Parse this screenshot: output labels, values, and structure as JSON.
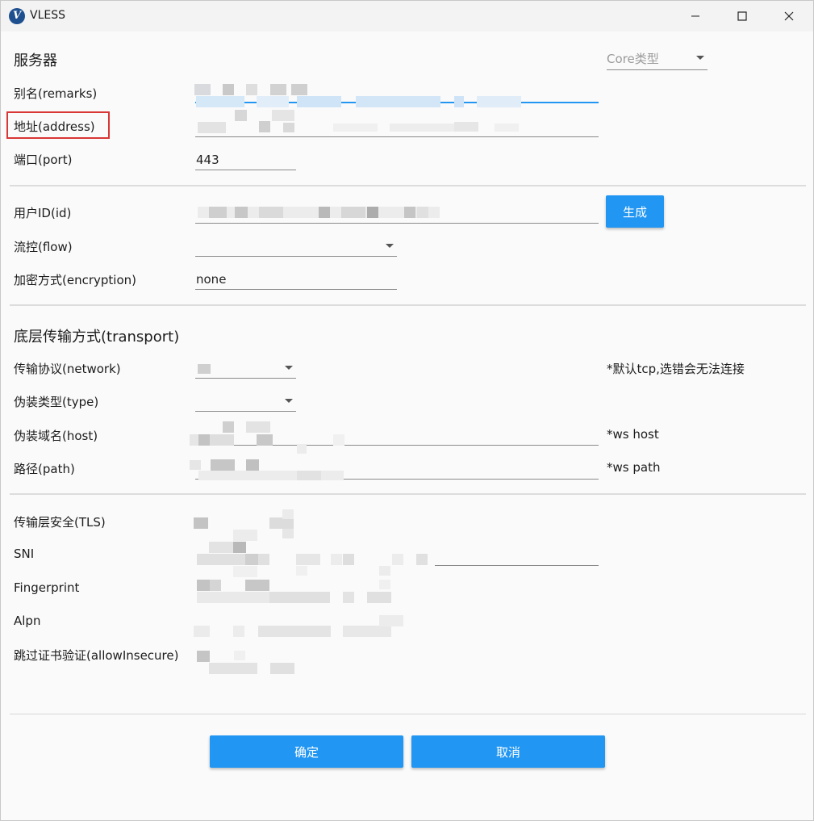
{
  "window": {
    "title": "VLESS",
    "icon": "v2rayn-logo-icon",
    "controls": [
      "minimize-icon",
      "maximize-icon",
      "close-icon"
    ]
  },
  "server": {
    "section_title": "服务器",
    "core_type_placeholder": "Core类型",
    "remarks_label": "别名(remarks)",
    "address_label": "地址(address)",
    "port_label": "端口(port)",
    "port_value": "443"
  },
  "user": {
    "id_label": "用户ID(id)",
    "generate_button": "生成",
    "flow_label": "流控(flow)",
    "flow_value": "",
    "encryption_label": "加密方式(encryption)",
    "encryption_value": "none"
  },
  "transport": {
    "section_title": "底层传输方式(transport)",
    "network_label": "传输协议(network)",
    "network_note": "*默认tcp,选错会无法连接",
    "type_label": "伪装类型(type)",
    "type_value": "",
    "host_label": "伪装域名(host)",
    "host_note": "*ws host",
    "path_label": "路径(path)",
    "path_note": "*ws path"
  },
  "tls": {
    "tls_label": "传输层安全(TLS)",
    "sni_label": "SNI",
    "fingerprint_label": "Fingerprint",
    "alpn_label": "Alpn",
    "allow_insecure_label": "跳过证书验证(allowInsecure)"
  },
  "footer": {
    "ok_button": "确定",
    "cancel_button": "取消"
  },
  "colors": {
    "accent": "#2196f3",
    "highlight": "#d93636",
    "background": "#fafafa"
  }
}
